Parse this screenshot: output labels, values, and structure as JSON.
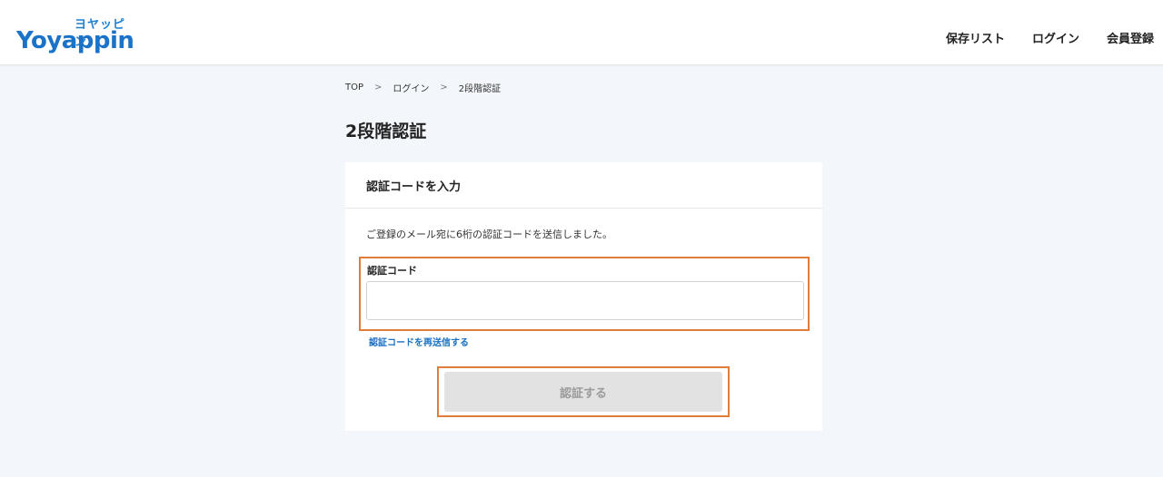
{
  "header": {
    "logo_kana": "ヨヤッピン",
    "logo_wordmark": "Yoyappin",
    "nav": {
      "saved_list": "保存リスト",
      "login": "ログイン",
      "register": "会員登録"
    }
  },
  "breadcrumb": {
    "items": [
      "TOP",
      "ログイン",
      "2段階認証"
    ],
    "separator": ">"
  },
  "page": {
    "title": "2段階認証"
  },
  "card": {
    "heading": "認証コードを入力",
    "description": "ご登録のメール宛に6桁の認証コードを送信しました。",
    "code_label": "認証コード",
    "code_value": "",
    "resend_link": "認証コードを再送信する",
    "submit_label": "認証する"
  },
  "colors": {
    "brand": "#1a73c8",
    "highlight": "#e07d3a",
    "link": "#1a6fc0",
    "disabled_button": "#e2e2e2",
    "background": "#f3f6fa"
  }
}
